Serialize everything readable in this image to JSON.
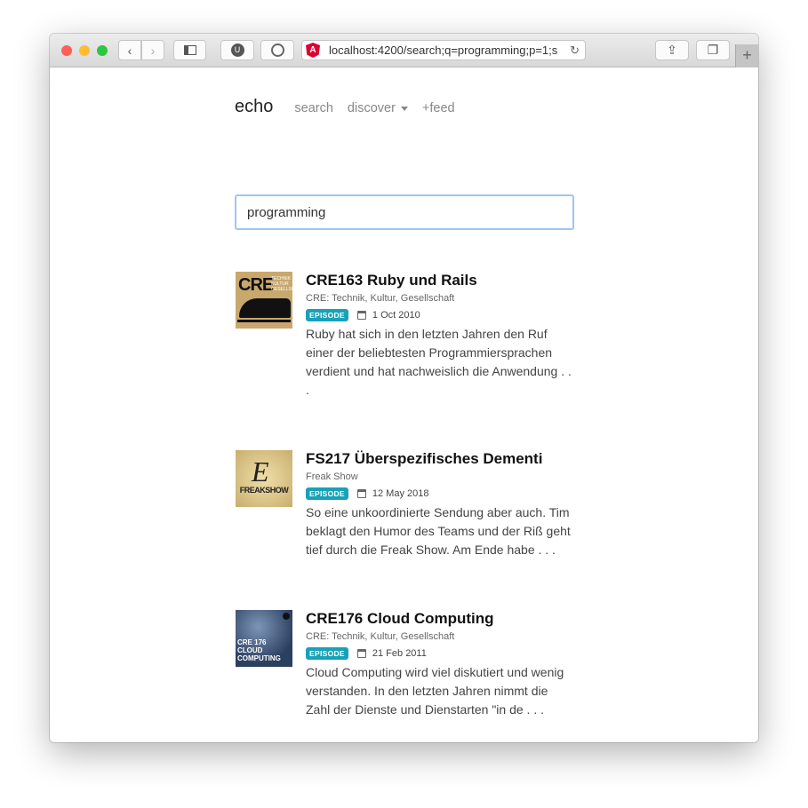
{
  "browser": {
    "url": "localhost:4200/search;q=programming;p=1;s",
    "colors": {
      "close": "#fe5f57",
      "minimize": "#febc2e",
      "zoom": "#28c840"
    }
  },
  "nav": {
    "brand": "echo",
    "links": [
      "search",
      "discover",
      "+feed"
    ]
  },
  "search": {
    "value": "programming"
  },
  "results": [
    {
      "title": "CRE163 Ruby und Rails",
      "podcast": "CRE: Technik, Kultur, Gesellschaft",
      "badge": "EPISODE",
      "date": "1 Oct 2010",
      "description": "Ruby hat sich in den letzten Jahren den Ruf einer der beliebtesten Programmiersprachen verdient und hat nachweislich die Anwendung . . .",
      "logo": "CRE TECHNIK KULTUR GESELLSCHAFT"
    },
    {
      "title": "FS217 Überspezifisches Dementi",
      "podcast": "Freak Show",
      "badge": "EPISODE",
      "date": "12 May 2018",
      "description": "So eine unkoordinierte Sendung aber auch. Tim beklagt den Humor des Teams und der Riß geht tief durch die Freak Show. Am Ende habe . . .",
      "logo": "FREAKSHOW"
    },
    {
      "title": "CRE176 Cloud Computing",
      "podcast": "CRE: Technik, Kultur, Gesellschaft",
      "badge": "EPISODE",
      "date": "21 Feb 2011",
      "description": "Cloud Computing wird viel diskutiert und wenig verstanden. In den letzten Jahren nimmt die Zahl der Dienste und Dienstarten \"in de . . .",
      "logo": "CRE 176 CLOUD COMPUTING"
    }
  ],
  "colors": {
    "badge": "#17a2b8",
    "focus": "#9dc6f5"
  }
}
